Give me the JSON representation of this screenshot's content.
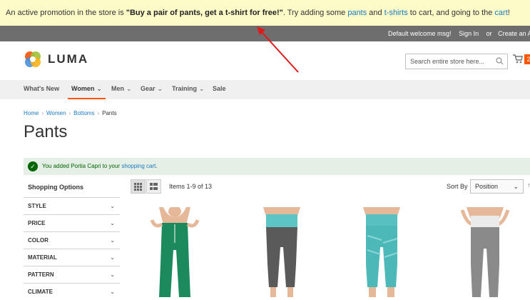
{
  "promo": {
    "prefix": "An active promotion in the store is ",
    "highlight": "\"Buy a pair of pants, get a t-shirt for free!\"",
    "middle": ". Try adding some ",
    "link_pants": "pants",
    "and": " and ",
    "link_tshirts": "t-shirts",
    "suffix": " to cart, and going to the ",
    "link_cart": "cart",
    "end": "!"
  },
  "topbar": {
    "welcome": "Default welcome msg!",
    "sign_in": "Sign In",
    "or": "or",
    "create_account": "Create an Account"
  },
  "header": {
    "logo_text": "LUMA",
    "search_placeholder": "Search entire store here...",
    "cart_count": "2"
  },
  "nav": {
    "items": [
      {
        "label": "What's New"
      },
      {
        "label": "Women"
      },
      {
        "label": "Men"
      },
      {
        "label": "Gear"
      },
      {
        "label": "Training"
      },
      {
        "label": "Sale"
      }
    ]
  },
  "breadcrumb": {
    "items": [
      "Home",
      "Women",
      "Bottoms",
      "Pants"
    ]
  },
  "page": {
    "title": "Pants"
  },
  "message": {
    "prefix": "You added Portia Capri to your ",
    "link": "shopping cart",
    "suffix": "."
  },
  "filters": {
    "heading": "Shopping Options",
    "items": [
      "STYLE",
      "PRICE",
      "COLOR",
      "MATERIAL",
      "PATTERN",
      "CLIMATE"
    ]
  },
  "toolbar": {
    "items_amount": "Items 1-9 of 13",
    "sort_label": "Sort By",
    "sort_value": "Position"
  },
  "colors": {
    "accent": "#ff5501",
    "link": "#1979c3",
    "promo_bg": "#fdfbc8",
    "success": "#006400"
  }
}
